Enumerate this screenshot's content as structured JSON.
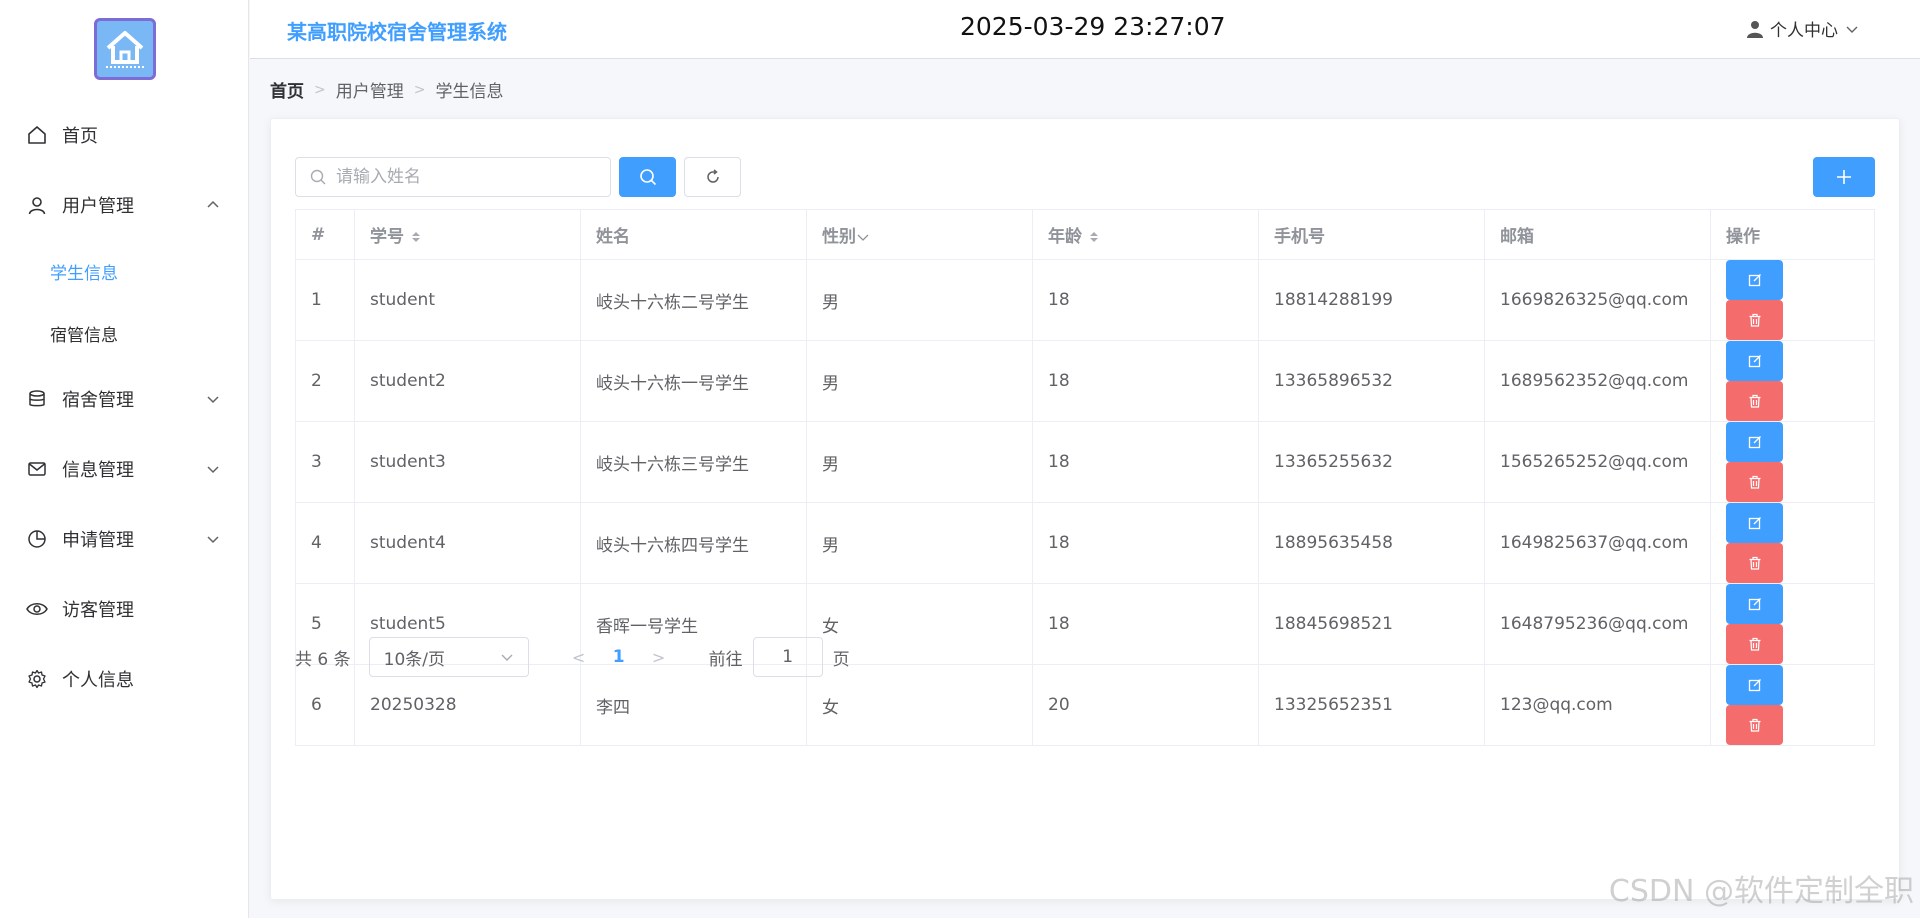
{
  "app": {
    "title": "某高职院校宿舍管理系统",
    "clock": "2025-03-29 23:27:07",
    "user_center": "个人中心"
  },
  "sidebar": {
    "items": [
      {
        "label": "首页",
        "icon": "home-icon"
      },
      {
        "label": "用户管理",
        "icon": "user-icon",
        "expanded": true,
        "children": [
          {
            "label": "学生信息",
            "active": true
          },
          {
            "label": "宿管信息"
          }
        ]
      },
      {
        "label": "宿舍管理",
        "icon": "database-icon"
      },
      {
        "label": "信息管理",
        "icon": "message-icon"
      },
      {
        "label": "申请管理",
        "icon": "pie-chart-icon"
      },
      {
        "label": "访客管理",
        "icon": "eye-icon"
      },
      {
        "label": "个人信息",
        "icon": "gear-icon"
      }
    ]
  },
  "breadcrumb": [
    "首页",
    "用户管理",
    "学生信息"
  ],
  "search": {
    "placeholder": "请输入姓名",
    "value": ""
  },
  "table": {
    "headers": [
      "#",
      "学号",
      "姓名",
      "性别",
      "年龄",
      "手机号",
      "邮箱",
      "操作"
    ],
    "rows": [
      [
        "1",
        "student",
        "岐头十六栋二号学生",
        "男",
        "18",
        "18814288199",
        "1669826325@qq.com"
      ],
      [
        "2",
        "student2",
        "岐头十六栋一号学生",
        "男",
        "18",
        "13365896532",
        "1689562352@qq.com"
      ],
      [
        "3",
        "student3",
        "岐头十六栋三号学生",
        "男",
        "18",
        "13365255632",
        "1565265252@qq.com"
      ],
      [
        "4",
        "student4",
        "岐头十六栋四号学生",
        "男",
        "18",
        "18895635458",
        "1649825637@qq.com"
      ],
      [
        "5",
        "student5",
        "香晖一号学生",
        "女",
        "18",
        "18845698521",
        "1648795236@qq.com"
      ],
      [
        "6",
        "20250328",
        "李四",
        "女",
        "20",
        "13325652351",
        "123@qq.com"
      ]
    ]
  },
  "pagination": {
    "total": "共 6 条",
    "page_size": "10条/页",
    "current": "1",
    "goto_label": "前往",
    "goto_value": "1",
    "page_label": "页"
  },
  "watermark": "CSDN @软件定制全职",
  "colors": {
    "primary": "#409eff",
    "danger": "#f56c6c"
  }
}
